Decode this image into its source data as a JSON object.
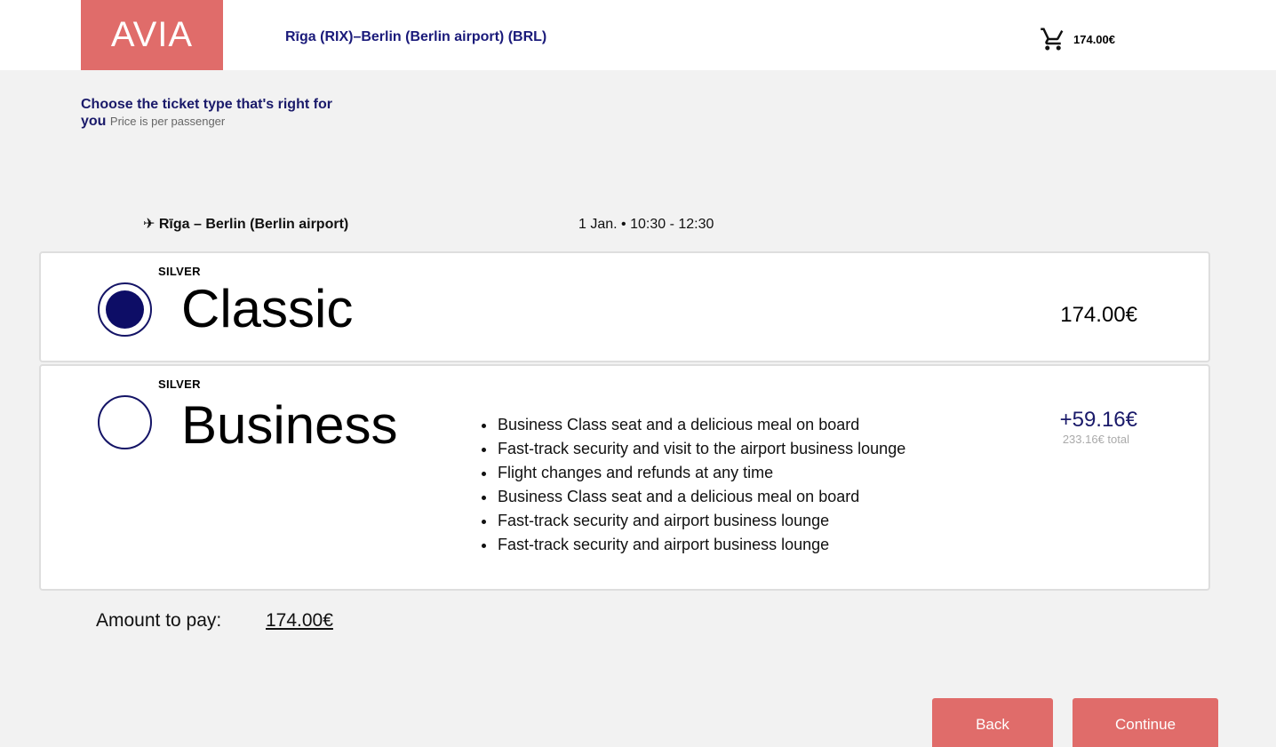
{
  "header": {
    "logo": "AVIA",
    "route": "Rīga (RIX)–Berlin (Berlin airport) (BRL)",
    "cart_total": "174.00€",
    "cart_icon": "cart-icon"
  },
  "intro": {
    "title": "Choose the ticket type that's right for you",
    "subtitle": "Price is per passenger"
  },
  "segment": {
    "plane_icon": "✈",
    "route": "Rīga – Berlin (Berlin airport)",
    "time": "1 Jan. • 10:30 - 12:30"
  },
  "fares": [
    {
      "tier": "SILVER",
      "name": "Classic",
      "price": "174.00€",
      "selected": true
    },
    {
      "tier": "SILVER",
      "name": "Business",
      "price_diff": "+59.16€",
      "price_total": "233.16€ total",
      "selected": false,
      "features": [
        "Business Class seat and a delicious meal on board",
        "Fast-track security and visit to the airport business lounge",
        "Flight changes and refunds at any time",
        "Business Class seat and a delicious meal on board",
        "Fast-track security and airport business lounge",
        "Fast-track security and airport business lounge"
      ]
    }
  ],
  "summary": {
    "amount_label": "Amount to pay:",
    "amount_value": "174.00€"
  },
  "actions": {
    "back_label": "Back",
    "continue_label": "Continue"
  },
  "colors": {
    "brand": "#e06c6a",
    "accent_navy": "#0d0d66",
    "background": "#f2f2f2"
  }
}
